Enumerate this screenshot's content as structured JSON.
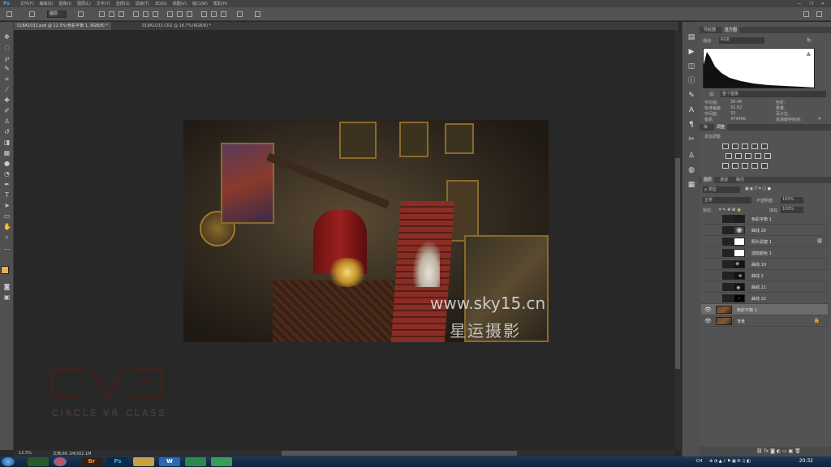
{
  "app": {
    "logo": "Ps",
    "menus": [
      "文件(F)",
      "编辑(E)",
      "图像(I)",
      "图层(L)",
      "文字(Y)",
      "选择(S)",
      "滤镜(T)",
      "3D(D)",
      "视图(V)",
      "窗口(W)",
      "帮助(H)"
    ],
    "window_controls": [
      "—",
      "❐",
      "✕"
    ]
  },
  "options_bar": {
    "auto_select_value": "图层"
  },
  "documents": {
    "tabs": [
      {
        "label": "018A1032.psd @ 12.5%(色彩平衡 1, RGB/8) *",
        "active": true
      },
      {
        "label": "018A1032.CR2 @ 16.7%(RGB/8) *",
        "active": false
      }
    ]
  },
  "canvas": {
    "watermark_url": "www.sky15.cn",
    "watermark_cn": "星运摄影",
    "brand_text": "CIRCLE VR CLASS"
  },
  "status": {
    "zoom": "12.5%",
    "doc_info": "文档:86.1M/302.1M"
  },
  "histogram_panel": {
    "tabs": [
      "导航器",
      "直方图"
    ],
    "channel_label": "通道:",
    "channel_value": "RGB",
    "source_label": "源:",
    "source_value": "整个图像",
    "stats_left": [
      {
        "label": "平均值:",
        "value": "39.46"
      },
      {
        "label": "标准偏差:",
        "value": "31.62"
      },
      {
        "label": "中间值:",
        "value": "33"
      },
      {
        "label": "像素:",
        "value": "479466"
      }
    ],
    "stats_right": [
      {
        "label": "色阶:",
        "value": ""
      },
      {
        "label": "数量:",
        "value": ""
      },
      {
        "label": "百分位:",
        "value": ""
      },
      {
        "label": "高速缓存级别:",
        "value": "4"
      }
    ]
  },
  "adjustments_panel": {
    "tabs": [
      "库",
      "调整"
    ],
    "title": "添加调整"
  },
  "layers_panel": {
    "tabs": [
      "图层",
      "通道",
      "路径"
    ],
    "filter_kind": "ρ 类型",
    "blend_mode": "正常",
    "opacity_label": "不透明度:",
    "opacity_value": "100%",
    "lock_label": "锁定:",
    "fill_label": "填充:",
    "fill_value": "100%",
    "layers": [
      {
        "name": "色彩平衡 1",
        "visible": false,
        "selected": false,
        "thumb": "dark"
      },
      {
        "name": "曲线 20",
        "visible": false,
        "selected": false,
        "thumb": "blob"
      },
      {
        "name": "照片滤镜 1",
        "visible": false,
        "selected": false,
        "thumb": "white"
      },
      {
        "name": "选取颜色 1",
        "visible": false,
        "selected": false,
        "thumb": "white"
      },
      {
        "name": "曲线 19",
        "visible": false,
        "selected": false,
        "thumb": "speck"
      },
      {
        "name": "曲线 2",
        "visible": false,
        "selected": false,
        "thumb": "speck"
      },
      {
        "name": "曲线 21",
        "visible": false,
        "selected": false,
        "thumb": "speck"
      },
      {
        "name": "曲线 22",
        "visible": false,
        "selected": false,
        "thumb": "dot"
      },
      {
        "name": "色彩平衡 1",
        "visible": true,
        "selected": true,
        "thumb": "photo"
      },
      {
        "name": "背景",
        "visible": true,
        "selected": false,
        "thumb": "photo"
      }
    ]
  },
  "taskbar": {
    "apps": [
      "",
      "",
      "Br",
      "Ps",
      "",
      "W",
      "",
      ""
    ],
    "tray_lang": "CH",
    "time": "20:32"
  }
}
